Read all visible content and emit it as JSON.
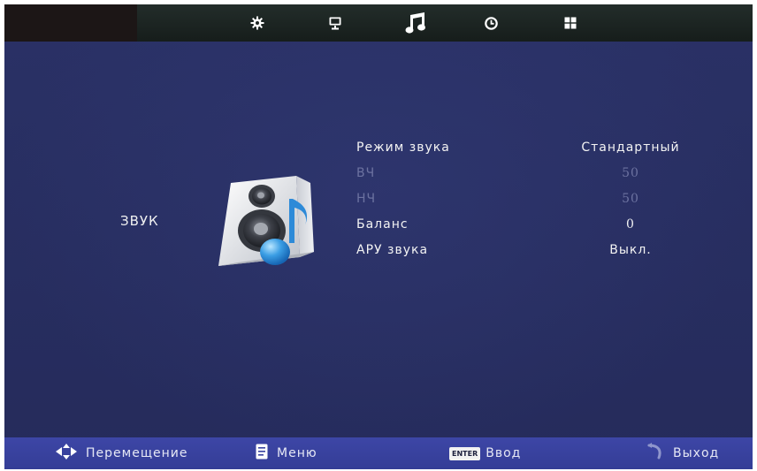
{
  "top_bar": {
    "tabs": [
      {
        "icon": "gear-icon",
        "active": false
      },
      {
        "icon": "monitor-icon",
        "active": false
      },
      {
        "icon": "music-note-icon",
        "active": true
      },
      {
        "icon": "clock-icon",
        "active": false
      },
      {
        "icon": "grid-icon",
        "active": false
      }
    ]
  },
  "menu": {
    "title": "ЗВУК",
    "icon": "speaker-icon"
  },
  "settings": [
    {
      "label": "Режим звука",
      "value": "Стандартный",
      "enabled": true
    },
    {
      "label": "ВЧ",
      "value": "50",
      "enabled": false
    },
    {
      "label": "НЧ",
      "value": "50",
      "enabled": false
    },
    {
      "label": "Баланс",
      "value": "0",
      "enabled": true
    },
    {
      "label": "АРУ звука",
      "value": "Выкл.",
      "enabled": true
    }
  ],
  "bottom_bar": {
    "move": "Перемещение",
    "menu": "Меню",
    "enter_key": "ENTER",
    "enter": "Ввод",
    "exit": "Выход"
  },
  "colors": {
    "background": "#272e61",
    "bottom_bar": "#3a43a0",
    "top_bar": "#1b2220",
    "disabled_text": "#6c72a0",
    "text": "#f3f3f3"
  }
}
